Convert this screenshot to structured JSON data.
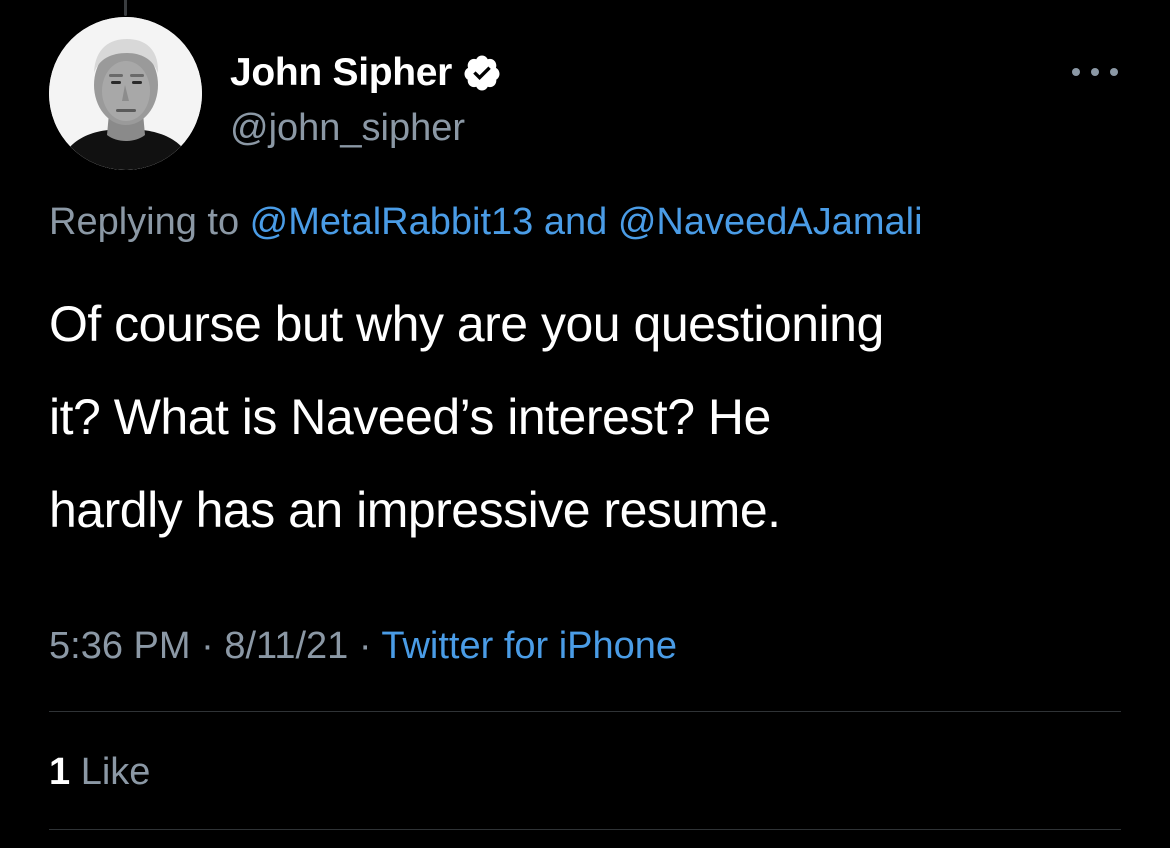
{
  "author": {
    "display_name": "John Sipher",
    "handle": "@john_sipher",
    "verified": true,
    "verified_icon": "verified-badge-icon",
    "avatar": "author-avatar"
  },
  "reply": {
    "prefix": "Replying to ",
    "mention_1": "@MetalRabbit13",
    "joiner": " and ",
    "mention_2": "@NaveedAJamali"
  },
  "tweet": {
    "text": "Of course but why are you questioning\nit? What is Naveed’s interest? He\nhardly has an impressive resume."
  },
  "meta": {
    "time": "5:36 PM",
    "separator_1": " · ",
    "date": "8/11/21",
    "separator_2": " · ",
    "source": "Twitter for iPhone"
  },
  "engagement": {
    "like_count": "1",
    "like_label": " Like"
  },
  "menu": {
    "icon": "more-options-icon"
  },
  "colors": {
    "background": "#000000",
    "primary_text": "#ffffff",
    "secondary_text": "#8b98a5",
    "link": "#4a9ce6",
    "divider": "#2f3336"
  }
}
